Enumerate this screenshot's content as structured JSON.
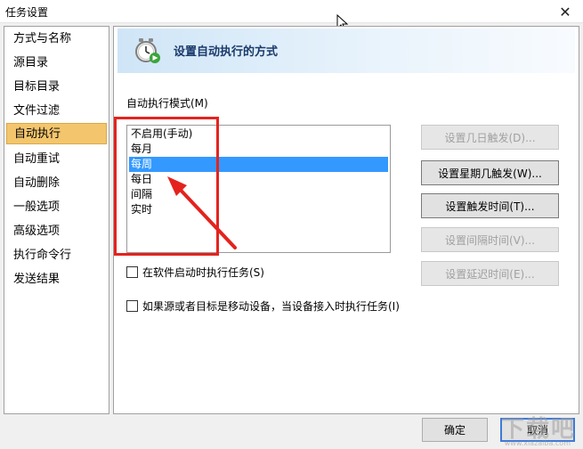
{
  "window": {
    "title": "任务设置"
  },
  "sidebar": {
    "items": [
      {
        "label": "方式与名称",
        "selected": false
      },
      {
        "label": "源目录",
        "selected": false
      },
      {
        "label": "目标目录",
        "selected": false
      },
      {
        "label": "文件过滤",
        "selected": false
      },
      {
        "label": "自动执行",
        "selected": true
      },
      {
        "label": "自动重试",
        "selected": false
      },
      {
        "label": "自动删除",
        "selected": false
      },
      {
        "label": "一般选项",
        "selected": false
      },
      {
        "label": "高级选项",
        "selected": false
      },
      {
        "label": "执行命令行",
        "selected": false
      },
      {
        "label": "发送结果",
        "selected": false
      }
    ]
  },
  "banner": {
    "title": "设置自动执行的方式",
    "icon": "clock-icon"
  },
  "mode": {
    "label": "自动执行模式(M)",
    "options": [
      "不启用(手动)",
      "每月",
      "每周",
      "每日",
      "间隔",
      "实时"
    ],
    "selected": "每周"
  },
  "checkboxes": {
    "on_startup": {
      "label": "在软件启动时执行任务(S)",
      "checked": false
    },
    "on_device": {
      "label": "如果源或者目标是移动设备，当设备接入时执行任务(I)",
      "checked": false
    }
  },
  "buttons": {
    "set_days": {
      "label": "设置几日触发(D)...",
      "enabled": false
    },
    "set_weekdays": {
      "label": "设置星期几触发(W)...",
      "enabled": true
    },
    "set_trigger_time": {
      "label": "设置触发时间(T)...",
      "enabled": true
    },
    "set_interval": {
      "label": "设置间隔时间(V)...",
      "enabled": false
    },
    "set_delay": {
      "label": "设置延迟时间(E)...",
      "enabled": false
    }
  },
  "footer": {
    "ok": "确定",
    "cancel": "取消"
  },
  "watermark": {
    "text": "下载吧",
    "sub": "www.xiazaiba.com"
  },
  "colors": {
    "selection": "#3399ff",
    "sidebar_selected": "#f3c66e",
    "annotation": "#e4231e"
  }
}
